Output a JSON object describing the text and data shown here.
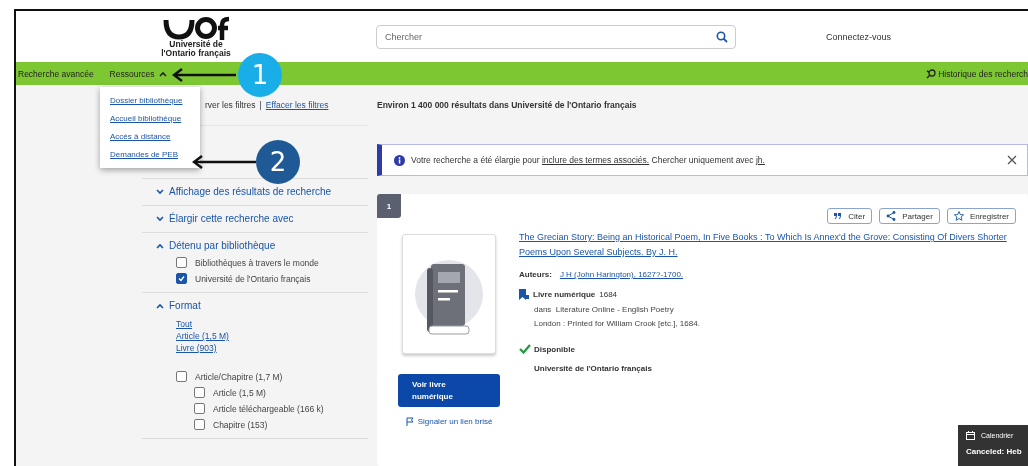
{
  "header": {
    "logo_line1": "Université de",
    "logo_line2": "l'Ontario français",
    "search_placeholder": "Chercher",
    "login": "Connectez-vous"
  },
  "nav": {
    "items": [
      {
        "label": "Recherche avancée",
        "kind": "link"
      },
      {
        "label": "Ressources",
        "kind": "menu",
        "expanded": true
      }
    ],
    "history": "Historique des recherch"
  },
  "dropdown": [
    "Dossier bibliothèque",
    "Accueil bibliothèque",
    "Accès à distance",
    "Demandes de PEB"
  ],
  "filter_bar": {
    "keep_filters": "rver les filtres",
    "separator": "|",
    "clear_filters": "Effacer les filtres",
    "result_count": "Environ 1 400 000 résultats dans Université de l'Ontario français"
  },
  "facets": [
    {
      "label": "Affichage des résultats de recherche",
      "expanded": false
    },
    {
      "label": "Élargir cette recherche avec",
      "expanded": false
    },
    {
      "label": "Détenu par bibliothèque",
      "expanded": true,
      "options": [
        {
          "label": "Bibliothèques à travers le monde",
          "checked": false
        },
        {
          "label": "Université de l'Ontario français",
          "checked": true
        }
      ]
    },
    {
      "label": "Format",
      "expanded": true,
      "links": [
        "Tout",
        "Article (1,5 M)",
        "Livre (903)"
      ],
      "options": [
        {
          "label": "Article/Chapitre (1,7 M)",
          "checked": false,
          "children": [
            {
              "label": "Article (1,5 M)",
              "checked": false
            },
            {
              "label": "Article téléchargeable (166 k)",
              "checked": false
            },
            {
              "label": "Chapitre (153)",
              "checked": false
            }
          ]
        }
      ]
    }
  ],
  "notice": {
    "before": "Votre recherche a été élargie pour",
    "link": "inclure des termes associés.",
    "middle": "Chercher uniquement avec",
    "link2": "jh."
  },
  "result": {
    "number": "1",
    "actions": [
      {
        "label": "Citer",
        "kind": "quote"
      },
      {
        "label": "Partager",
        "kind": "share"
      },
      {
        "label": "Enregistrer",
        "kind": "star"
      }
    ],
    "title": "The Grecian Story: Being an Historical Poem, In Five Books : To Which Is Annex'd the Grove: Consisting Of Divers Shorter Poems Upon Several Subjects. By J. H.",
    "authors_label": "Auteurs:",
    "author": "J H (John Harington), 1627?-1700.",
    "format": "Livre numérique",
    "year": "1684",
    "source": "dans  Literature Online - English Poetry",
    "publisher": "London : Printed for William Crook [etc.], 1684.",
    "availability": "Disponible",
    "available": true,
    "library": "Université de l'Ontario français",
    "view_button": "Voir livre numérique",
    "report_link": "Signaler un lien brisé"
  },
  "calendar": {
    "label": "Calendrier",
    "event": "Canceled: Heb"
  },
  "annotations": [
    {
      "number": "1",
      "color": "#1aaee8"
    },
    {
      "number": "2",
      "color": "#1f5a96"
    }
  ]
}
